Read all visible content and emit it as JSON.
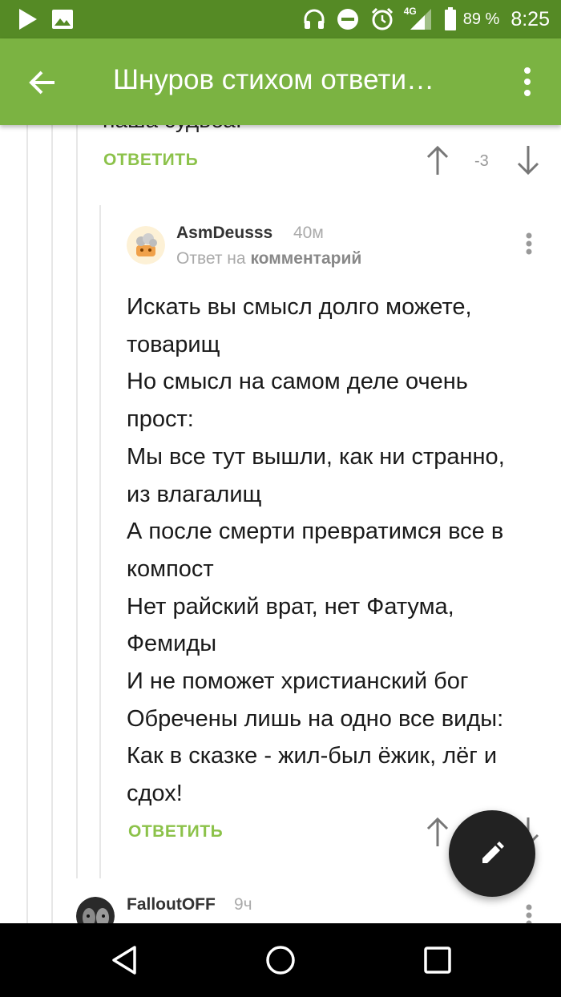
{
  "status_bar": {
    "battery_percent": "89 %",
    "time": "8:25",
    "network": "4G",
    "icons": [
      "play-icon",
      "image-icon",
      "headphones-icon",
      "do-not-disturb-icon",
      "alarm-icon",
      "signal-icon",
      "battery-icon"
    ]
  },
  "app_bar": {
    "title": "Шнуров стихом ответи…",
    "icons": [
      "back-arrow-icon",
      "more-vert-icon"
    ]
  },
  "previous_comment": {
    "cut_text": "наша судьба.",
    "reply_label": "ОТВЕТИТЬ",
    "score": "-3"
  },
  "comment": {
    "username": "AsmDeusss",
    "time": "40м",
    "reply_prefix": "Ответ на",
    "reply_target": "комментарий",
    "lines": [
      "Искать вы смысл долго можете,",
      "товарищ",
      "Но смысл на самом деле очень",
      "прост:",
      "Мы все тут вышли, как ни странно,",
      "из влагалищ",
      "А после смерти превратимся все в",
      "компост",
      "Нет райский врат, нет Фатума,",
      "Фемиды",
      "И не поможет христианский бог",
      "Обречены лишь на одно все виды:",
      "Как в сказке - жил-был ёжик, лёг и",
      "сдох!"
    ],
    "reply_label": "ОТВЕТИТЬ"
  },
  "next_comment": {
    "username": "FalloutOFF",
    "time": "9ч"
  },
  "fab": {
    "icon": "pencil-icon"
  },
  "nav_bar": {
    "icons": [
      "back-triangle-icon",
      "home-circle-icon",
      "recents-square-icon"
    ]
  },
  "colors": {
    "status_bar": "#558a25",
    "app_bar": "#7bb342",
    "accent_green": "#8cc24a",
    "fab": "#222222",
    "nav_bar": "#000000"
  }
}
